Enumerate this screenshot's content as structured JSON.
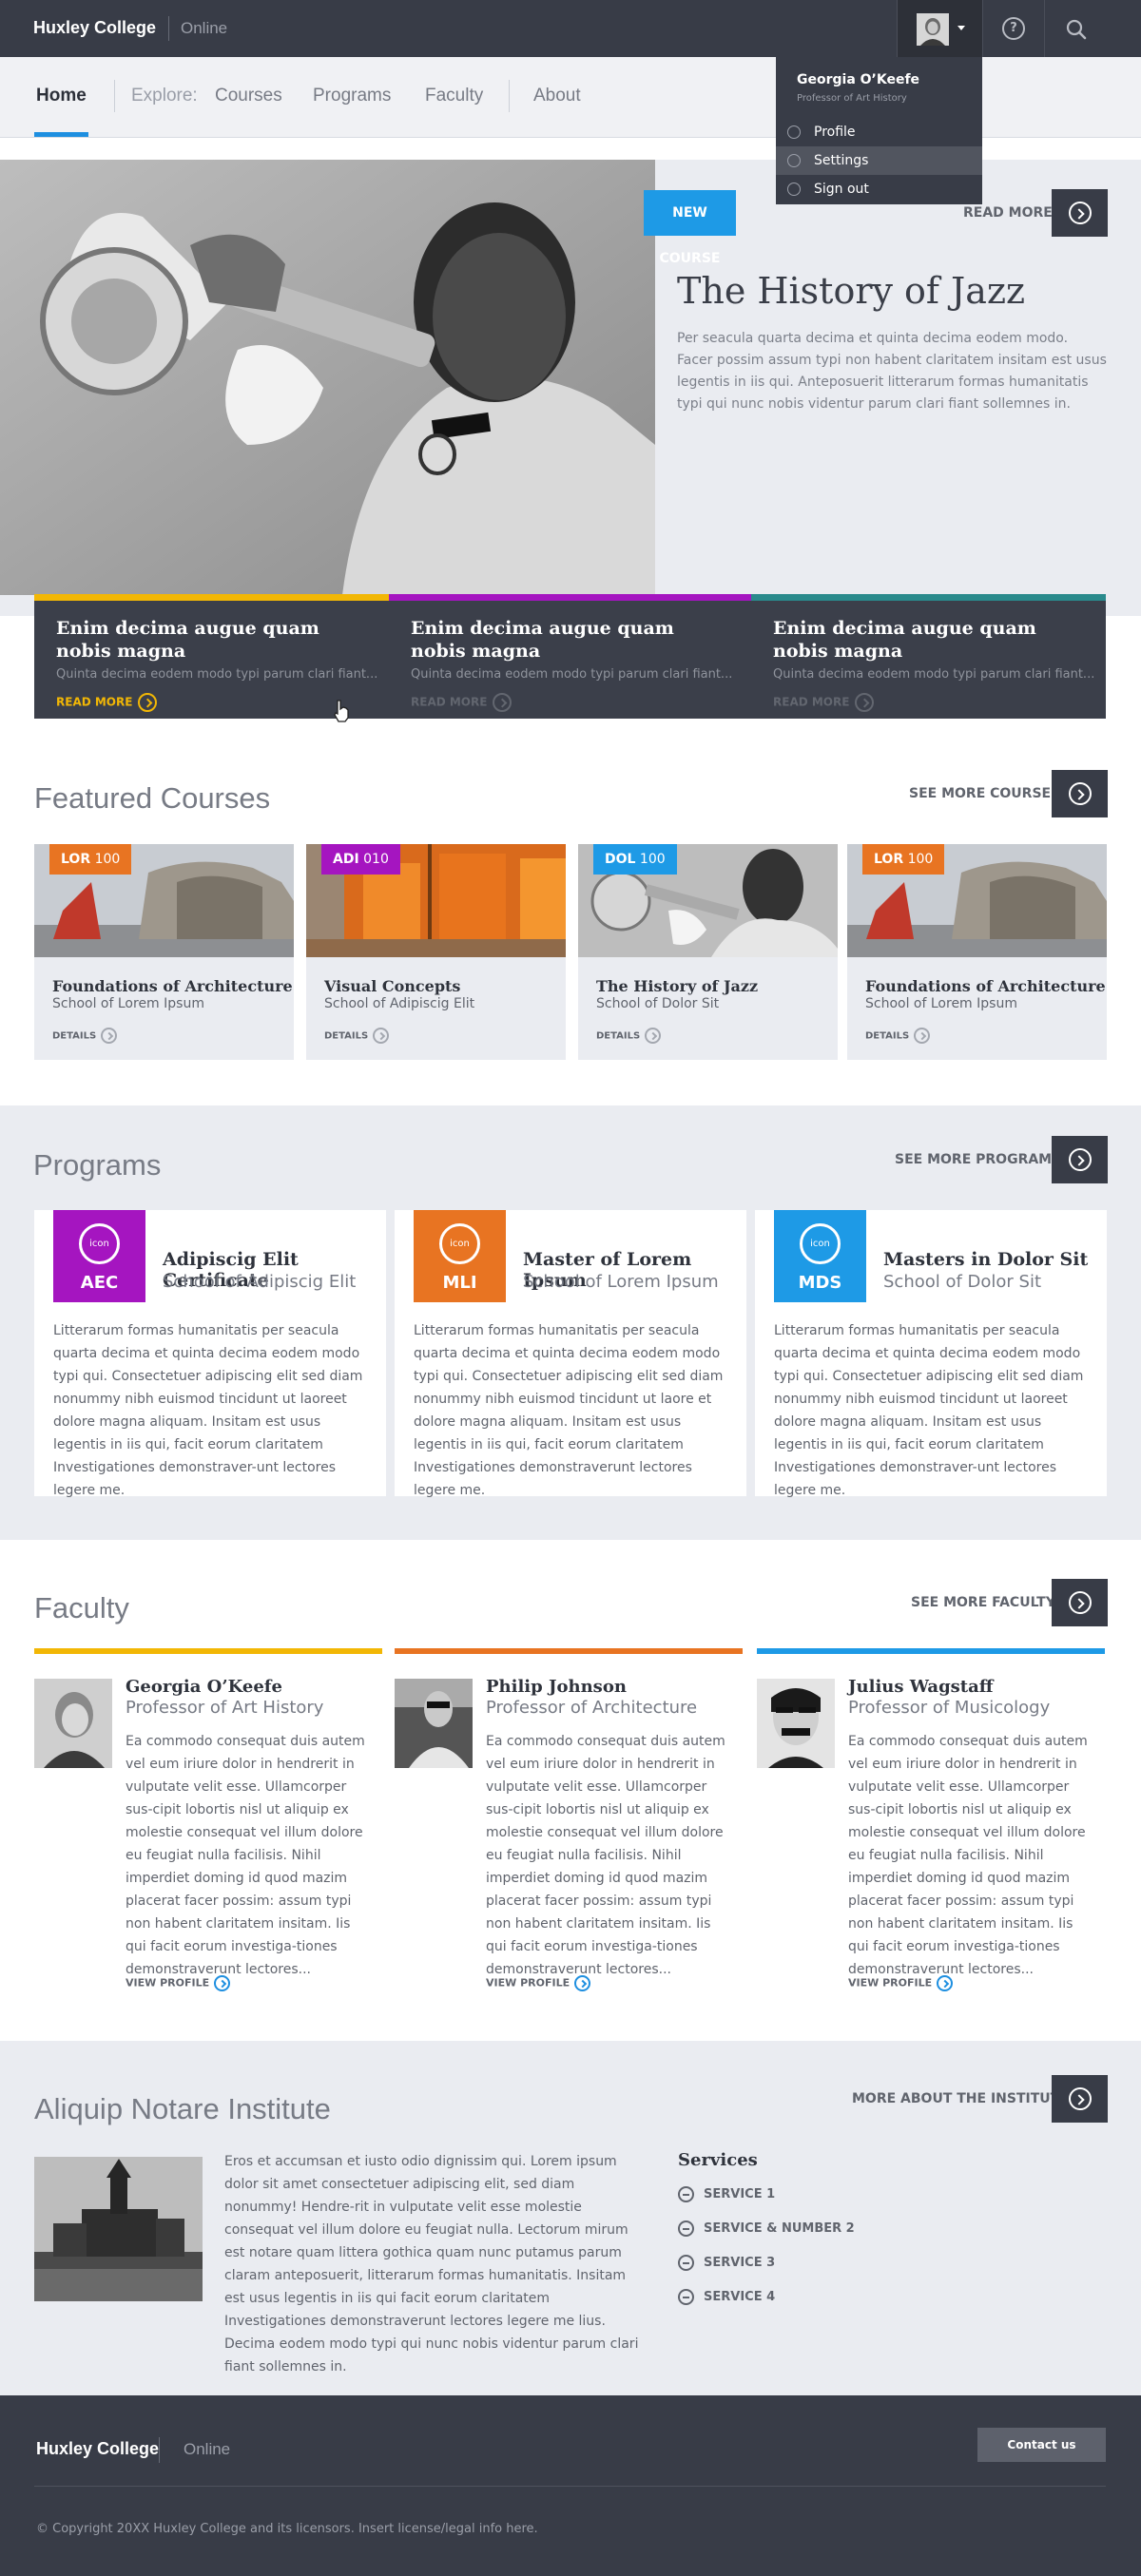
{
  "header": {
    "brand": "Huxley College",
    "brand_sub": "Online",
    "help_glyph": "?"
  },
  "nav": {
    "home": "Home",
    "explore": "Explore:",
    "items": [
      "Courses",
      "Programs",
      "Faculty",
      "About"
    ]
  },
  "user_menu": {
    "name": "Georgia O’Keefe",
    "role": "Professor of Art History",
    "items": [
      "Profile",
      "Settings",
      "Sign out"
    ],
    "highlighted": "Settings"
  },
  "hero": {
    "tag": "NEW COURSE",
    "read_more": "READ MORE",
    "title": "The History of Jazz",
    "description": "Per seacula quarta decima et quinta decima eodem modo. Facer possim assum typi non habent claritatem insitam est usus legentis in iis qui. Anteposuerit litterarum formas humanitatis typi qui nunc nobis videntur parum clari fiant sollemnes in."
  },
  "feature_cards": [
    {
      "title": "Enim decima augue quam nobis magna",
      "text": "Quinta decima eodem modo typi parum clari fiant...",
      "link": "READ MORE",
      "color": "#f2b705"
    },
    {
      "title": "Enim decima augue quam nobis magna",
      "text": "Quinta decima eodem modo typi parum clari fiant...",
      "link": "READ MORE",
      "color": "#a515c0"
    },
    {
      "title": "Enim decima augue quam nobis magna",
      "text": "Quinta decima eodem modo typi parum clari fiant...",
      "link": "READ MORE",
      "color": "#2a8a8c"
    }
  ],
  "featured": {
    "title": "Featured Courses",
    "see_more": "SEE MORE COURSES",
    "courses": [
      {
        "code": "LOR",
        "num": "100",
        "color": "#e87422",
        "title": "Foundations of Architecture",
        "school": "School of Lorem Ipsum",
        "link": "DETAILS"
      },
      {
        "code": "ADI",
        "num": "010",
        "color": "#a515c0",
        "title": "Visual Concepts",
        "school": "School of Adipiscig Elit",
        "link": "DETAILS"
      },
      {
        "code": "DOL",
        "num": "100",
        "color": "#1e9ae6",
        "title": "The History of Jazz",
        "school": "School of Dolor Sit",
        "link": "DETAILS"
      },
      {
        "code": "LOR",
        "num": "100",
        "color": "#e87422",
        "title": "Foundations of Architecture",
        "school": "School of Lorem Ipsum",
        "link": "DETAILS"
      }
    ]
  },
  "programs": {
    "title": "Programs",
    "see_more": "SEE MORE PROGRAMS",
    "icon_text": "icon",
    "items": [
      {
        "code": "AEC",
        "color": "#a515c0",
        "title": "Adipiscig Elit Certificate",
        "school": "School of Adipiscig Elit",
        "text": "Litterarum formas humanitatis per seacula quarta decima et quinta decima eodem modo typi qui. Consectetuer adipiscing elit sed diam nonummy nibh euismod tincidunt ut laoreet dolore magna aliquam. Insitam est usus legentis in iis qui, facit eorum claritatem Investigationes demonstraver-unt lectores legere me."
      },
      {
        "code": "MLI",
        "color": "#e87422",
        "title": "Master of Lorem Ipsum",
        "school": "School of Lorem Ipsum",
        "text": "Litterarum formas humanitatis per seacula quarta decima et quinta decima eodem modo typi qui. Consectetuer adipiscing elit sed diam nonummy nibh euismod tincidunt ut laore et dolore magna aliquam. Insitam est usus legentis in iis qui, facit eorum claritatem Investigationes demonstraverunt lectores legere me."
      },
      {
        "code": "MDS",
        "color": "#1e9ae6",
        "title": "Masters in Dolor Sit",
        "school": "School of Dolor Sit",
        "text": "Litterarum formas humanitatis per seacula quarta decima et quinta decima eodem modo typi qui. Consectetuer adipiscing elit sed diam nonummy nibh euismod tincidunt ut laoreet dolore magna aliquam. Insitam est usus legentis in iis qui, facit eorum claritatem Investigationes demonstraver-unt lectores legere me."
      }
    ]
  },
  "faculty": {
    "title": "Faculty",
    "see_more": "SEE MORE FACULTY",
    "members": [
      {
        "name": "Georgia O’Keefe",
        "role": "Professor of Art History",
        "color": "#f2b705",
        "text": "Ea commodo consequat duis autem vel eum iriure dolor in hendrerit in vulputate velit esse. Ullamcorper sus-cipit lobortis nisl ut aliquip ex molestie consequat vel illum dolore eu feugiat nulla facilisis. Nihil imperdiet doming id quod mazim placerat facer possim: assum typi non habent claritatem insitam. Iis qui facit eorum investiga-tiones demonstraverunt lectores...",
        "link": "VIEW PROFILE"
      },
      {
        "name": "Philip Johnson",
        "role": "Professor of Architecture",
        "color": "#e87422",
        "text": "Ea commodo consequat duis autem vel eum iriure dolor in hendrerit in vulputate velit esse. Ullamcorper sus-cipit lobortis nisl ut aliquip ex molestie consequat vel illum dolore eu feugiat nulla facilisis. Nihil imperdiet doming id quod mazim placerat facer possim: assum typi non habent claritatem insitam. Iis qui facit eorum investiga-tiones demonstraverunt lectores...",
        "link": "VIEW PROFILE"
      },
      {
        "name": "Julius Wagstaff",
        "role": "Professor of Musicology",
        "color": "#1e9ae6",
        "text": "Ea commodo consequat duis autem vel eum iriure dolor in hendrerit in vulputate velit esse. Ullamcorper sus-cipit lobortis nisl ut aliquip ex molestie consequat vel illum dolore eu feugiat nulla facilisis. Nihil imperdiet doming id quod mazim placerat facer possim: assum typi non habent claritatem insitam. Iis qui facit eorum investiga-tiones demonstraverunt lectores...",
        "link": "VIEW PROFILE"
      }
    ]
  },
  "institute": {
    "title": "Aliquip Notare Institute",
    "more": "MORE ABOUT THE INSTITUTE",
    "text": "Eros et accumsan et iusto odio dignissim qui. Lorem ipsum dolor sit amet consectetuer adipiscing elit, sed diam nonummy! Hendre-rit in vulputate velit esse molestie consequat vel illum dolore eu feugiat nulla. Lectorum mirum est notare quam littera gothica quam nunc putamus parum claram anteposuerit, litterarum formas humanitatis. Insitam est usus legentis in iis qui facit eorum claritatem Investigationes demonstraverunt lectores legere me lius. Decima eodem modo typi qui nunc nobis videntur parum clari fiant sollemnes in.",
    "services_title": "Services",
    "services": [
      "SERVICE 1",
      "SERVICE & NUMBER 2",
      "SERVICE 3",
      "SERVICE 4"
    ]
  },
  "footer": {
    "brand": "Huxley College",
    "brand_sub": "Online",
    "contact": "Contact us",
    "copyright": "© Copyright 20XX Huxley College and its licensors. Insert license/legal info here."
  }
}
